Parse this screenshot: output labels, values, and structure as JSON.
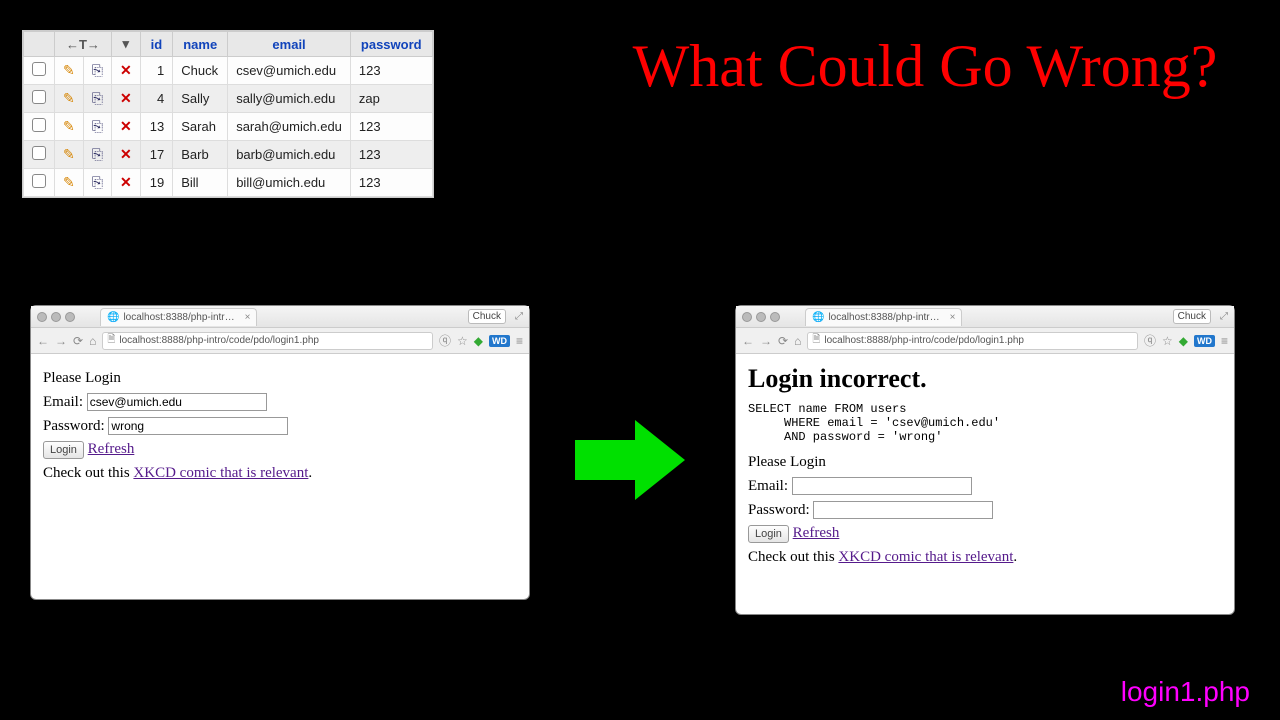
{
  "title": "What Could Go Wrong?",
  "filename": "login1.php",
  "db": {
    "headers": {
      "id": "id",
      "name": "name",
      "email": "email",
      "password": "password"
    },
    "toolbar": {
      "sort": "←T→",
      "dropdown": "▾"
    },
    "rows": [
      {
        "id": "1",
        "name": "Chuck",
        "email": "csev@umich.edu",
        "password": "123"
      },
      {
        "id": "4",
        "name": "Sally",
        "email": "sally@umich.edu",
        "password": "zap"
      },
      {
        "id": "13",
        "name": "Sarah",
        "email": "sarah@umich.edu",
        "password": "123"
      },
      {
        "id": "17",
        "name": "Barb",
        "email": "barb@umich.edu",
        "password": "123"
      },
      {
        "id": "19",
        "name": "Bill",
        "email": "bill@umich.edu",
        "password": "123"
      }
    ]
  },
  "browsers": {
    "tab_title": "localhost:8388/php-intr…",
    "address": "localhost:8888/php-intro/code/pdo/login1.php",
    "user_button": "Chuck",
    "left": {
      "please": "Please Login",
      "email_label": "Email:",
      "email_value": "csev@umich.edu",
      "password_label": "Password:",
      "password_value": "wrong",
      "login_btn": "Login",
      "refresh_link": "Refresh",
      "footer_prefix": "Check out this ",
      "footer_link": "XKCD comic that is relevant",
      "footer_suffix": "."
    },
    "right": {
      "heading": "Login incorrect.",
      "sql": "SELECT name FROM users\n     WHERE email = 'csev@umich.edu'\n     AND password = 'wrong'",
      "please": "Please Login",
      "email_label": "Email:",
      "email_value": "",
      "password_label": "Password:",
      "password_value": "",
      "login_btn": "Login",
      "refresh_link": "Refresh",
      "footer_prefix": "Check out this ",
      "footer_link": "XKCD comic that is relevant",
      "footer_suffix": "."
    }
  }
}
